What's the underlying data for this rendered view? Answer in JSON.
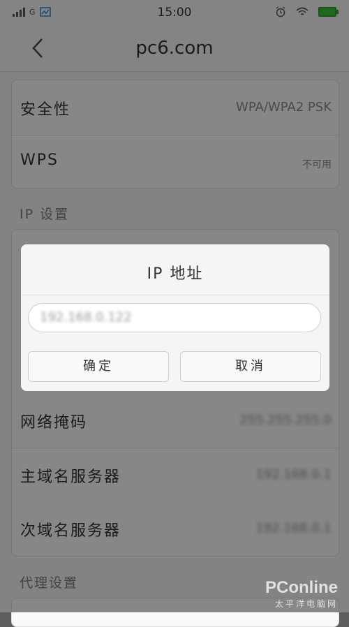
{
  "status_bar": {
    "network_type": "G",
    "time": "15:00"
  },
  "app_bar": {
    "title": "pc6.com"
  },
  "security_card": {
    "rows": [
      {
        "label": "安全性",
        "value": "WPA/WPA2 PSK"
      },
      {
        "label": "WPS",
        "value": "不可用"
      }
    ]
  },
  "ip_settings": {
    "header": "IP 设置",
    "rows": [
      {
        "label": "网络掩码",
        "value": "255.255.255.0"
      },
      {
        "label": "主域名服务器",
        "value": "192.168.0.1"
      },
      {
        "label": "次域名服务器",
        "value": "192.168.0.1"
      }
    ]
  },
  "proxy_settings": {
    "header": "代理设置"
  },
  "dialog": {
    "title": "IP 地址",
    "ip_value": "192.168.0.122",
    "confirm_label": "确定",
    "cancel_label": "取消"
  },
  "watermark": {
    "logo": "PConline",
    "subtitle": "太平洋电脑网"
  }
}
